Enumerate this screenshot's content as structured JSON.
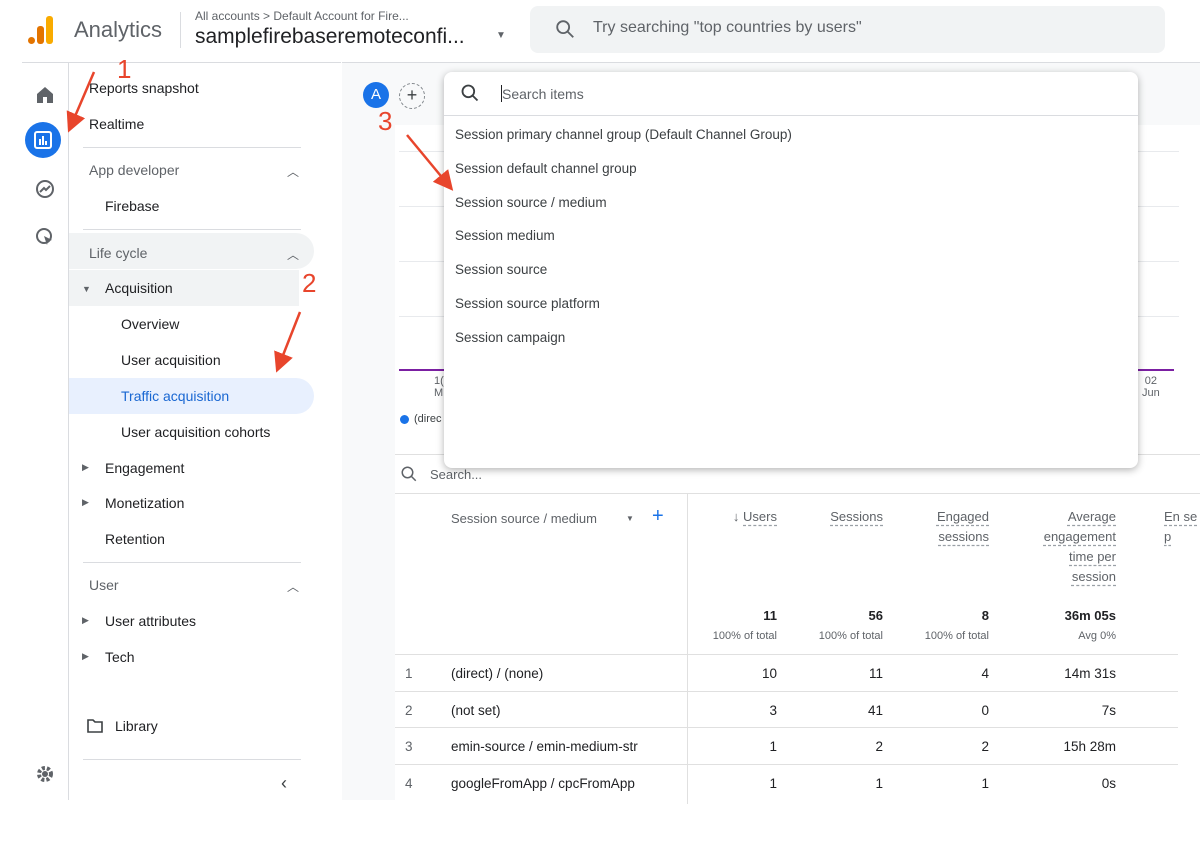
{
  "header": {
    "brand": "Analytics",
    "breadcrumb": "All accounts > Default Account for Fire...",
    "property": "samplefirebaseremoteconfi...",
    "search_placeholder": "Try searching \"top countries by users\""
  },
  "rail": {
    "items": [
      "home-icon",
      "reports-icon",
      "explore-icon",
      "advertising-icon",
      "settings-icon"
    ],
    "accent": "#1a73e8"
  },
  "nav": {
    "reports_snapshot": "Reports snapshot",
    "realtime": "Realtime",
    "app_developer": "App developer",
    "firebase": "Firebase",
    "life_cycle": "Life cycle",
    "acquisition": "Acquisition",
    "overview": "Overview",
    "user_acquisition": "User acquisition",
    "traffic_acquisition": "Traffic acquisition",
    "user_acquisition_cohorts": "User acquisition cohorts",
    "engagement": "Engagement",
    "monetization": "Monetization",
    "retention": "Retention",
    "user": "User",
    "user_attributes": "User attributes",
    "tech": "Tech",
    "library": "Library"
  },
  "comparison": {
    "avatar": "A"
  },
  "chart": {
    "x_left_partial": "1(\nM",
    "x_right": "02\nJun",
    "legend_partial": "(direc"
  },
  "dropdown": {
    "placeholder": "Search items",
    "options": [
      "Session primary channel group (Default Channel Group)",
      "Session default channel group",
      "Session source / medium",
      "Session medium",
      "Session source",
      "Session source platform",
      "Session campaign"
    ]
  },
  "table": {
    "search_placeholder": "Search...",
    "dimension": "Session source / medium",
    "columns": [
      {
        "label": "Users",
        "total": "11",
        "sub": "100% of total"
      },
      {
        "label": "Sessions",
        "total": "56",
        "sub": "100% of total"
      },
      {
        "label": "Engaged sessions",
        "total": "8",
        "sub": "100% of total"
      },
      {
        "label": "Average engagement time per session",
        "total": "36m 05s",
        "sub": "Avg 0%"
      },
      {
        "label": "En se p"
      }
    ],
    "rows": [
      [
        "1",
        "(direct) / (none)",
        "10",
        "11",
        "4",
        "14m 31s"
      ],
      [
        "2",
        "(not set)",
        "3",
        "41",
        "0",
        "7s"
      ],
      [
        "3",
        "emin-source / emin-medium-str",
        "1",
        "2",
        "2",
        "15h 28m"
      ],
      [
        "4",
        "googleFromApp / cpcFromApp",
        "1",
        "1",
        "1",
        "0s"
      ]
    ]
  },
  "annotations": {
    "n1": "1",
    "n2": "2",
    "n3": "3",
    "color": "#e8452c"
  }
}
